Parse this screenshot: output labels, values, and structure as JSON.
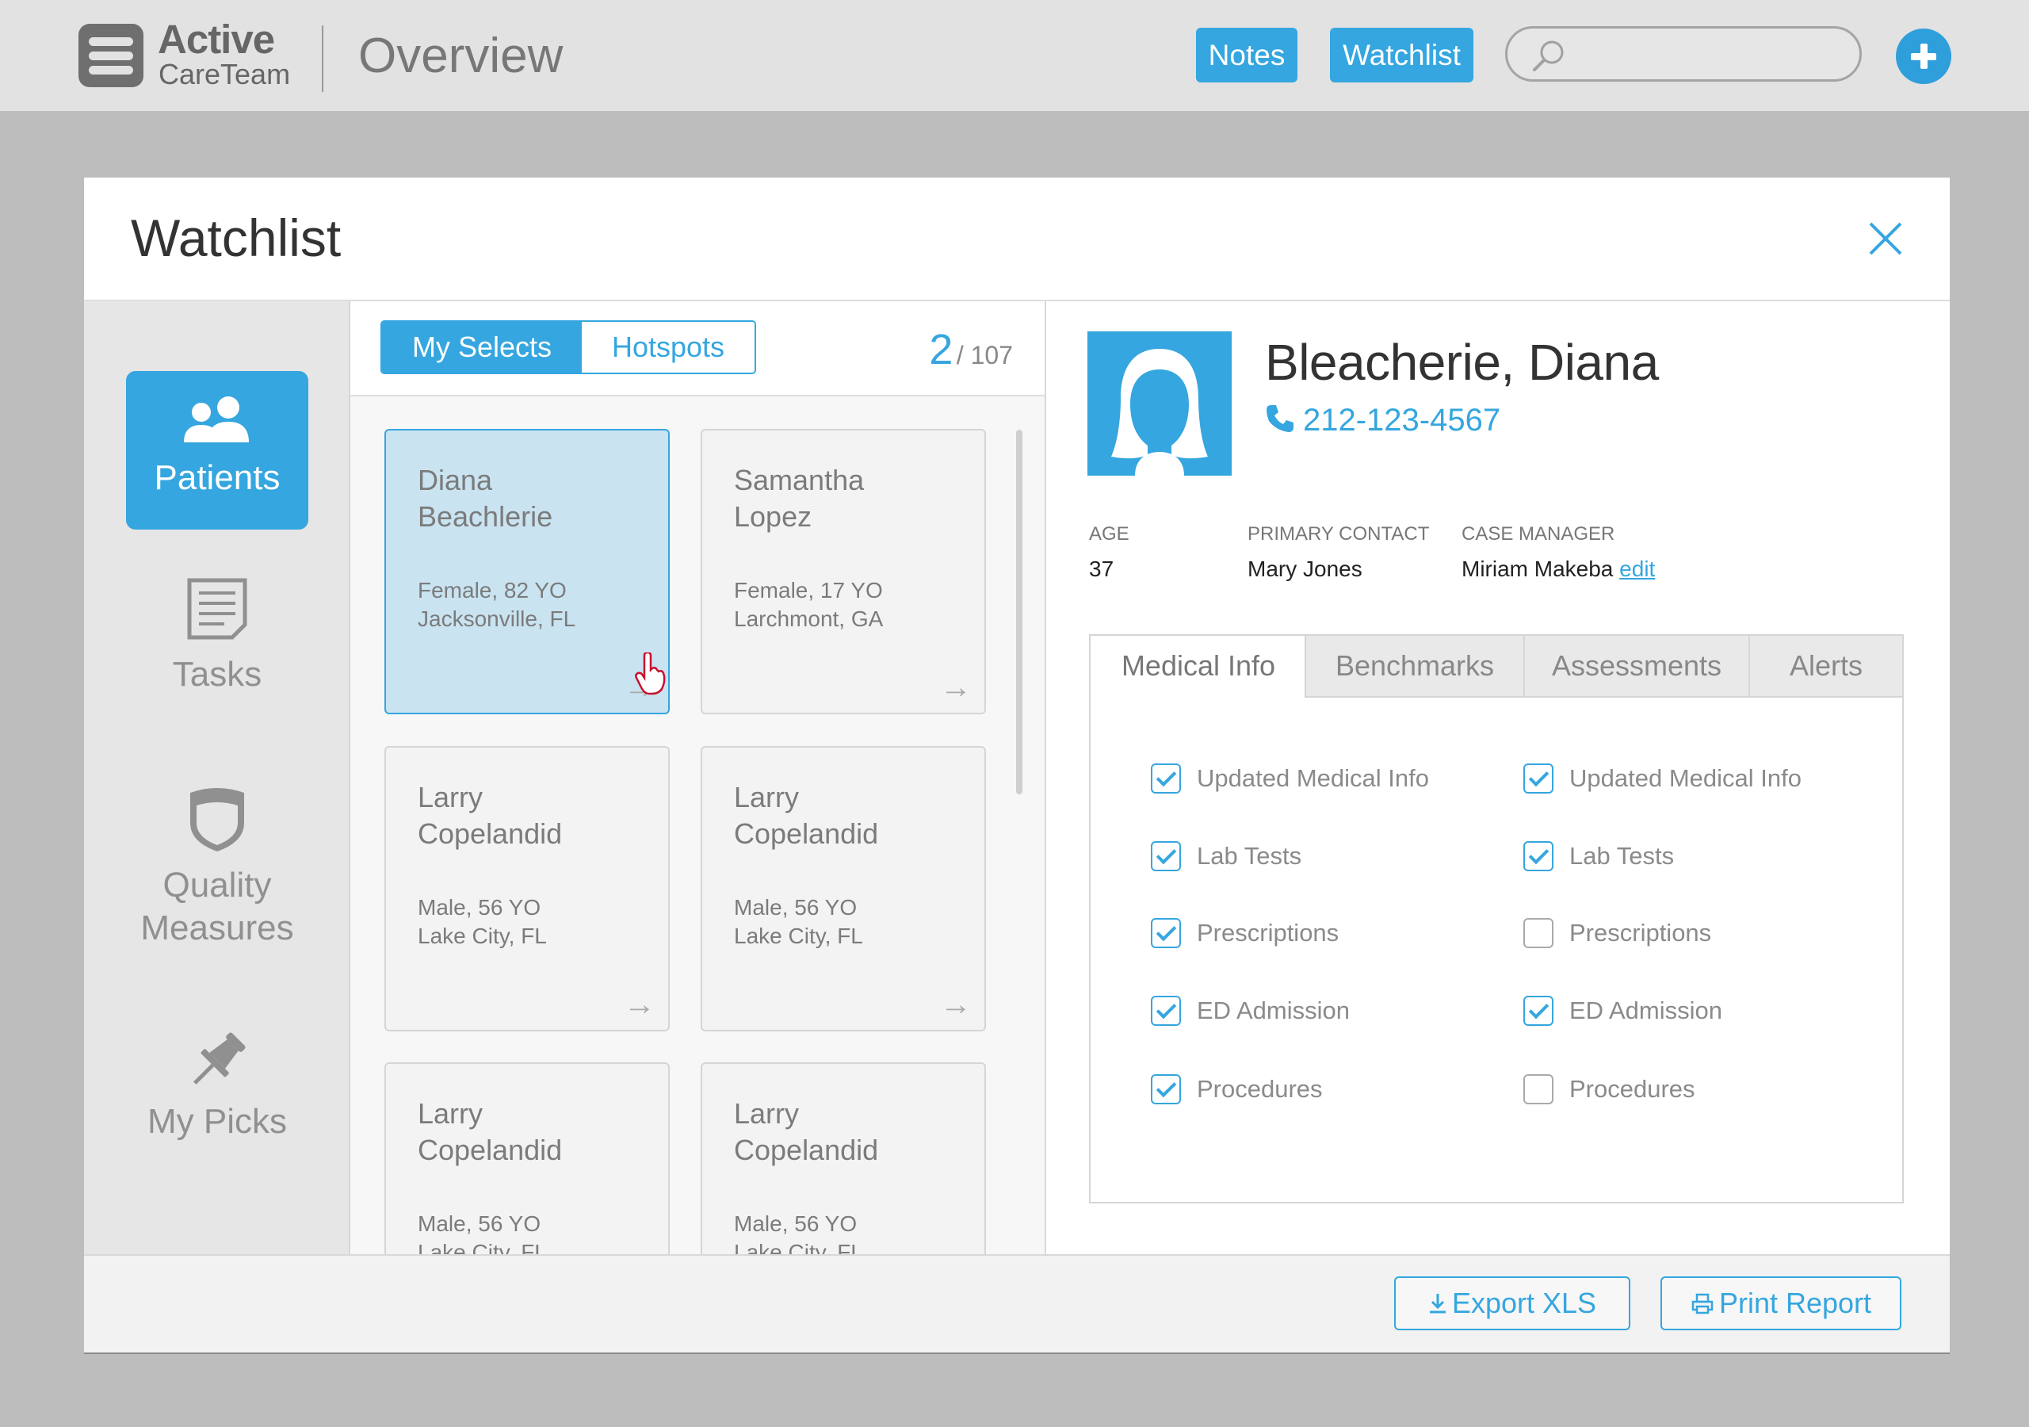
{
  "app": {
    "logo_title": "Active",
    "logo_subtitle": "CareTeam",
    "page_title": "Overview",
    "notes_label": "Notes",
    "watchlist_label": "Watchlist",
    "search_placeholder": ""
  },
  "modal": {
    "title": "Watchlist",
    "nav": [
      {
        "label": "Patients",
        "icon": "patients-icon",
        "active": true
      },
      {
        "label": "Tasks",
        "icon": "tasks-icon",
        "active": false
      },
      {
        "label_line1": "Quality",
        "label_line2": "Measures",
        "icon": "shield-icon",
        "active": false
      },
      {
        "label": "My Picks",
        "icon": "pin-icon",
        "active": false
      }
    ],
    "list": {
      "segments": [
        "My Selects",
        "Hotspots"
      ],
      "active_segment": "My Selects",
      "current": "2",
      "total": "/ 107",
      "cards": [
        {
          "first": "Diana",
          "last": "Beachlerie",
          "gender_age": "Female, 82 YO",
          "location": "Jacksonville, FL",
          "selected": true
        },
        {
          "first": "Samantha",
          "last": "Lopez",
          "gender_age": "Female, 17 YO",
          "location": "Larchmont, GA",
          "selected": false
        },
        {
          "first": "Larry",
          "last": "Copelandid",
          "gender_age": "Male, 56 YO",
          "location": "Lake City, FL",
          "selected": false
        },
        {
          "first": "Larry",
          "last": "Copelandid",
          "gender_age": "Male, 56 YO",
          "location": "Lake City, FL",
          "selected": false
        },
        {
          "first": "Larry",
          "last": "Copelandid",
          "gender_age": "Male, 56 YO",
          "location": "Lake City, FL",
          "selected": false
        },
        {
          "first": "Larry",
          "last": "Copelandid",
          "gender_age": "Male, 56 YO",
          "location": "Lake City, FL",
          "selected": false
        }
      ]
    },
    "detail": {
      "name": "Bleacherie, Diana",
      "phone": "212-123-4567",
      "age_label": "AGE",
      "age": "37",
      "contact_label": "PRIMARY CONTACT",
      "contact": "Mary Jones",
      "manager_label": "CASE MANAGER",
      "manager": "Miriam Makeba",
      "edit_label": "edit",
      "tabs": [
        "Medical Info",
        "Benchmarks",
        "Assessments",
        "Alerts"
      ],
      "active_tab": "Medical Info",
      "checklist_left": [
        {
          "label": "Updated Medical Info",
          "checked": true
        },
        {
          "label": "Lab Tests",
          "checked": true
        },
        {
          "label": "Prescriptions",
          "checked": true
        },
        {
          "label": "ED Admission",
          "checked": true
        },
        {
          "label": "Procedures",
          "checked": true
        }
      ],
      "checklist_right": [
        {
          "label": "Updated Medical Info",
          "checked": true
        },
        {
          "label": "Lab Tests",
          "checked": true
        },
        {
          "label": "Prescriptions",
          "checked": false
        },
        {
          "label": "ED Admission",
          "checked": true
        },
        {
          "label": "Procedures",
          "checked": false
        }
      ]
    },
    "footer": {
      "export_label": "Export XLS",
      "print_label": "Print Report"
    }
  },
  "colors": {
    "accent": "#35a6df",
    "topbar": "#e2e2e2",
    "backdrop": "#bdbdbd",
    "selected_card": "#c9e3f1"
  }
}
